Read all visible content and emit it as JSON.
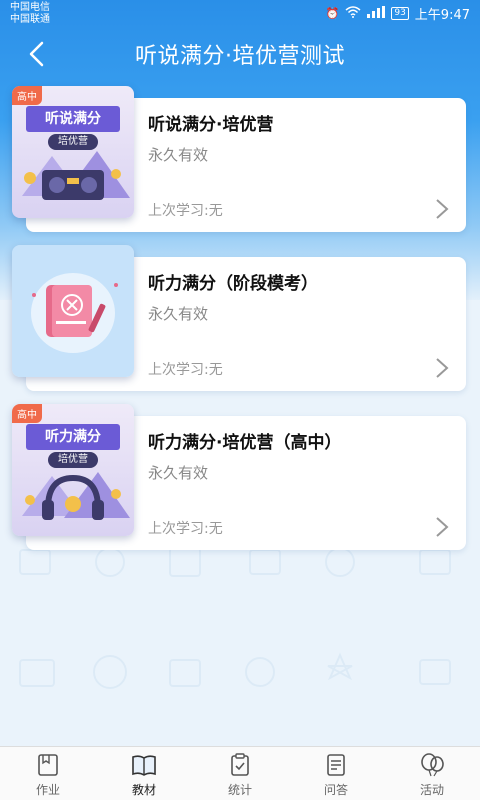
{
  "status_bar": {
    "carrier_1": "中国电信",
    "carrier_2": "中国联通",
    "battery": "93",
    "time": "上午9:47"
  },
  "header": {
    "title": "听说满分·培优营测试",
    "back_icon": "chevron-left-icon"
  },
  "courses": [
    {
      "badge": "高中",
      "thumb_title": "听说满分",
      "thumb_tag": "培优营",
      "title": "听说满分·培优营",
      "validity": "永久有效",
      "last_study": "上次学习:无"
    },
    {
      "badge": "",
      "title": "听力满分（阶段模考）",
      "validity": "永久有效",
      "last_study": "上次学习:无"
    },
    {
      "badge": "高中",
      "thumb_title": "听力满分",
      "thumb_tag": "培优营",
      "title": "听力满分·培优营（高中）",
      "validity": "永久有效",
      "last_study": "上次学习:无"
    }
  ],
  "nav": {
    "items": [
      {
        "label": "作业",
        "icon": "homework-icon"
      },
      {
        "label": "教材",
        "icon": "book-icon"
      },
      {
        "label": "统计",
        "icon": "clipboard-icon"
      },
      {
        "label": "问答",
        "icon": "qa-icon"
      },
      {
        "label": "活动",
        "icon": "balloon-icon"
      }
    ],
    "active": "教材"
  },
  "colors": {
    "header_blue": "#2a8fe8",
    "badge_red": "#f06a4a",
    "thumb_purple": "#6b5bd6"
  }
}
